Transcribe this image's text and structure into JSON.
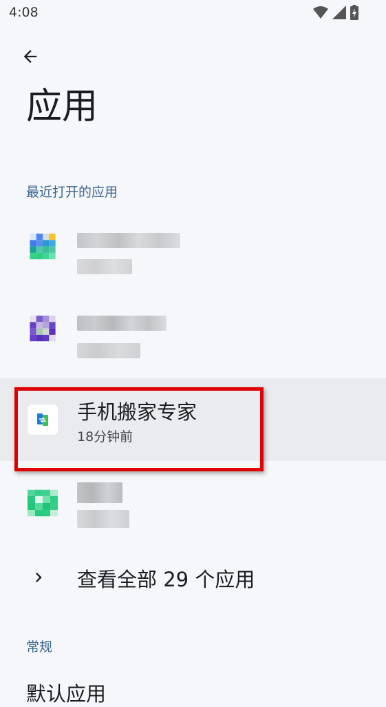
{
  "status_bar": {
    "time": "4:08"
  },
  "header": {
    "title": "应用"
  },
  "recent_section": {
    "header": "最近打开的应用",
    "apps": [
      {
        "name": "",
        "subtitle": "",
        "blurred": true,
        "icon": "blurred-app-icon"
      },
      {
        "name": "",
        "subtitle": "",
        "blurred": true,
        "icon": "blurred-app-icon"
      },
      {
        "name": "手机搬家专家",
        "subtitle": "18分钟前",
        "blurred": false,
        "icon": "phone-clone-app-icon"
      },
      {
        "name": "",
        "subtitle": "",
        "blurred": true,
        "icon": "blurred-app-icon"
      }
    ],
    "see_all_label": "查看全部 29 个应用"
  },
  "general_section": {
    "header": "常规",
    "first_item": "默认应用"
  },
  "colors": {
    "accent": "#3a6691",
    "highlight_border": "#e00000",
    "background": "#f5f7fa"
  }
}
